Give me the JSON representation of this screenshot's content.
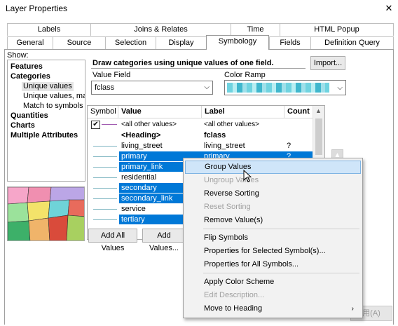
{
  "window": {
    "title": "Layer Properties",
    "close_glyph": "✕"
  },
  "tabs_row1": [
    "Labels",
    "Joins & Relates",
    "Time",
    "HTML Popup"
  ],
  "tabs_row2": [
    "General",
    "Source",
    "Selection",
    "Display",
    "Symbology",
    "Fields",
    "Definition Query"
  ],
  "active_tab": "Symbology",
  "show": {
    "label": "Show:",
    "items": [
      "Features",
      "Categories",
      "Unique values",
      "Unique values, many",
      "Match to symbols in a",
      "Quantities",
      "Charts",
      "Multiple Attributes"
    ],
    "selected": "Unique values"
  },
  "description": "Draw categories using unique values of one field.",
  "import_button": "Import...",
  "value_field": {
    "label": "Value Field",
    "value": "fclass"
  },
  "color_ramp": {
    "label": "Color Ramp"
  },
  "table": {
    "columns": [
      "Symbol",
      "Value",
      "Label",
      "Count"
    ],
    "rows": [
      {
        "value": "<all other values>",
        "label": "<all other values>",
        "count": "",
        "selected": false,
        "checkbox": true,
        "bold": false
      },
      {
        "value": "<Heading>",
        "label": "fclass",
        "count": "",
        "selected": false,
        "checkbox": false,
        "bold": true
      },
      {
        "value": "living_street",
        "label": "living_street",
        "count": "?",
        "selected": false
      },
      {
        "value": "primary",
        "label": "primary",
        "count": "?",
        "selected": true
      },
      {
        "value": "primary_link",
        "label": "",
        "count": "",
        "selected": true
      },
      {
        "value": "residential",
        "label": "",
        "count": "",
        "selected": false
      },
      {
        "value": "secondary",
        "label": "",
        "count": "",
        "selected": true
      },
      {
        "value": "secondary_link",
        "label": "",
        "count": "",
        "selected": true
      },
      {
        "value": "service",
        "label": "",
        "count": "",
        "selected": false
      },
      {
        "value": "tertiary",
        "label": "",
        "count": "",
        "selected": true
      }
    ]
  },
  "buttons": {
    "add_all": "Add All Values",
    "add": "Add Values..."
  },
  "context_menu": {
    "items": [
      {
        "label": "Group Values",
        "state": "highlighted"
      },
      {
        "label": "Ungroup Values",
        "state": "disabled"
      },
      {
        "label": "Reverse Sorting",
        "state": "enabled"
      },
      {
        "label": "Reset Sorting",
        "state": "disabled"
      },
      {
        "label": "Remove Value(s)",
        "state": "enabled"
      },
      {
        "label": "Flip Symbols",
        "state": "enabled"
      },
      {
        "label": "Properties for Selected Symbol(s)...",
        "state": "enabled"
      },
      {
        "label": "Properties for All Symbols...",
        "state": "enabled"
      },
      {
        "label": "Apply Color Scheme",
        "state": "enabled"
      },
      {
        "label": "Edit Description...",
        "state": "disabled"
      },
      {
        "label": "Move to Heading",
        "state": "enabled",
        "submenu": true
      }
    ]
  },
  "apply_button": "用(A)",
  "colors": {
    "selection": "#0078d7",
    "menu_highlight": "#cfe5f9",
    "symbol_line": "#7fb6c2"
  }
}
